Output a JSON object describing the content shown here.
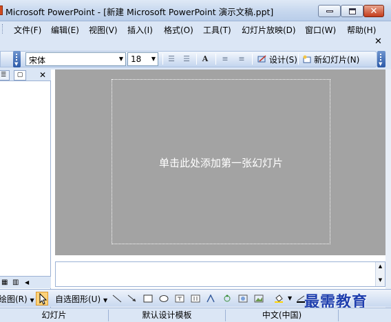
{
  "window": {
    "title": "Microsoft PowerPoint - [新建 Microsoft PowerPoint 演示文稿.ppt]"
  },
  "menu": {
    "items": [
      {
        "label": "文件(F)"
      },
      {
        "label": "编辑(E)"
      },
      {
        "label": "视图(V)"
      },
      {
        "label": "插入(I)"
      },
      {
        "label": "格式(O)"
      },
      {
        "label": "工具(T)"
      },
      {
        "label": "幻灯片放映(D)"
      },
      {
        "label": "窗口(W)"
      },
      {
        "label": "帮助(H)"
      }
    ]
  },
  "toolbar": {
    "font_name": "宋体",
    "font_size": "18",
    "design_label": "设计(S)",
    "new_slide_label": "新幻灯片(N)"
  },
  "slide": {
    "hint": "单击此处添加第一张幻灯片"
  },
  "drawing": {
    "draw_label": "绘图(R)",
    "autoshapes_label": "自选图形(U)"
  },
  "status": {
    "slide": "幻灯片",
    "template": "默认设计模板",
    "language": "中文(中国)"
  },
  "watermark": "最需教育",
  "colors": {
    "slide_area": "#a3a3a3",
    "chrome": "#dbe6f5",
    "watermark": "#1f3fae"
  }
}
